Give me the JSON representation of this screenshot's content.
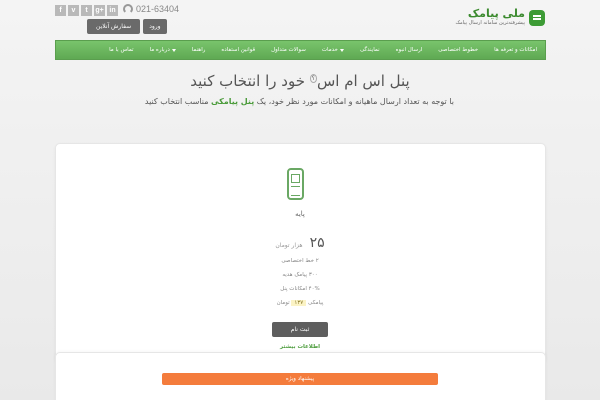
{
  "brand": {
    "name": "ملی پیامک",
    "tagline": "پیشرفته‌ترین سامانه ارسال پیامک"
  },
  "topbar": {
    "socials": [
      {
        "icon": "facebook-icon",
        "glyph": "f"
      },
      {
        "icon": "vimeo-icon",
        "glyph": "v"
      },
      {
        "icon": "twitter-icon",
        "glyph": "t"
      },
      {
        "icon": "googleplus-icon",
        "glyph": "g+"
      },
      {
        "icon": "linkedin-icon",
        "glyph": "in"
      }
    ],
    "phone": "021-63404",
    "order_online": "سفارش آنلاین",
    "login": "ورود"
  },
  "nav": [
    {
      "label": "امکانات و تعرفه ها"
    },
    {
      "label": "خطوط اختصاصی"
    },
    {
      "label": "ارسال انبوه"
    },
    {
      "label": "نمایندگی"
    },
    {
      "label": "خدمات",
      "dropdown": true
    },
    {
      "label": "سوالات متداول"
    },
    {
      "label": "قوانین استفاده"
    },
    {
      "label": "راهنما"
    },
    {
      "label": "درباره ما",
      "dropdown": true
    },
    {
      "label": "تماس با ما"
    }
  ],
  "hero": {
    "title_main": "پنل اس ام اس",
    "title_sup": "؟",
    "title_rest": " خود را انتخاب کنید",
    "subtitle_pre": "با توجه به تعداد ارسال ماهیانه و امکانات مورد نظر خود، یک ",
    "subtitle_hl": "پنل پیامکی",
    "subtitle_post": " مناسب انتخاب کنید"
  },
  "plan": {
    "name": "پایه",
    "price": "۲۵",
    "price_unit": "هزار تومان",
    "feature_1": "۲ خط اختصاصی",
    "feature_2": "۳۰۰ پیامک هدیه",
    "feature_3": "۴۰% امکانات پنل",
    "cost_label": "پیامکی",
    "cost_value": "۱۳۷",
    "cost_unit": "تومان",
    "register": "ثبت نام",
    "more_info": "اطلاعات بیشتر"
  },
  "special_offer": "پیشنهاد ویژه"
}
